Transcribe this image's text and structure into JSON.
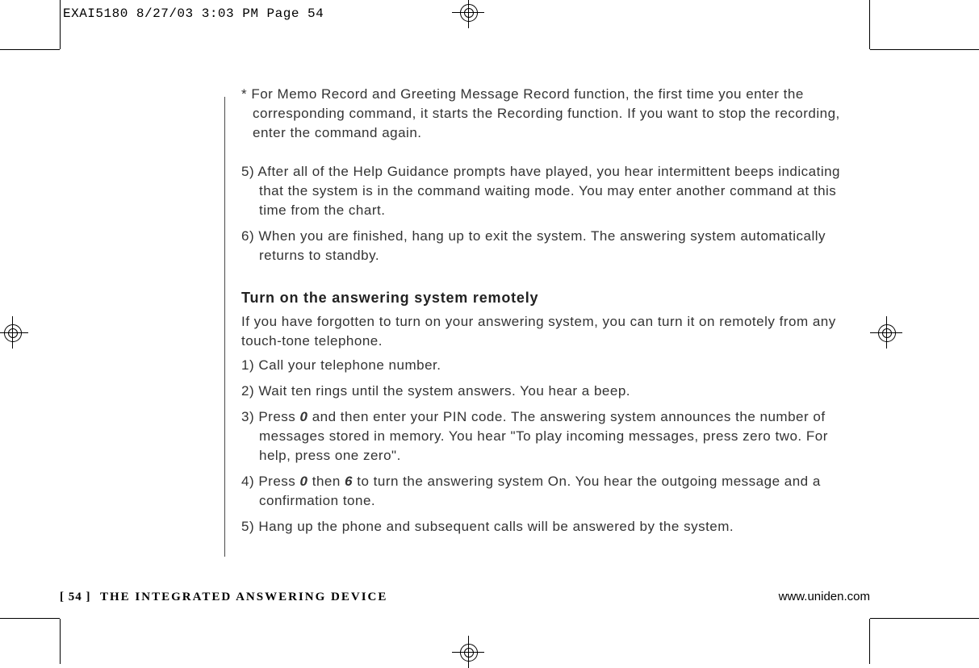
{
  "slug": "EXAI5180  8/27/03 3:03 PM  Page 54",
  "body": {
    "note": "* For Memo Record and Greeting Message Record function, the first time you enter the corresponding command, it starts the Recording function. If you want to stop the recording, enter the command again.",
    "step5": "5) After all of the Help Guidance prompts have played, you hear intermittent beeps indicating that the system is in the command waiting mode. You may enter another command at this time from the chart.",
    "step6": "6) When you are finished, hang up to exit the system. The answering system automatically returns to standby.",
    "subhead": "Turn on the answering system remotely",
    "intro": "If you have forgotten to turn on your answering system, you can turn it on remotely from any touch-tone telephone.",
    "r1": "1) Call your telephone number.",
    "r2": "2) Wait ten rings until the system answers. You hear a beep.",
    "r3a": "3) Press ",
    "r3key1": "0",
    "r3b": " and then enter your PIN code. The answering system announces the number of messages stored in memory. You hear \"To play incoming messages, press zero two. For help, press one zero\".",
    "r4a": "4) Press ",
    "r4key1": "0",
    "r4b": " then ",
    "r4key2": "6",
    "r4c": " to turn the answering system On. You hear the outgoing message and a confirmation tone.",
    "r5": "5) Hang up the phone and subsequent calls will be answered by the system."
  },
  "footer": {
    "page_bracket_open": "[ ",
    "page_number": "54",
    "page_bracket_close": " ]",
    "section_title": "THE INTEGRATED ANSWERING DEVICE",
    "url": "www.uniden.com"
  }
}
